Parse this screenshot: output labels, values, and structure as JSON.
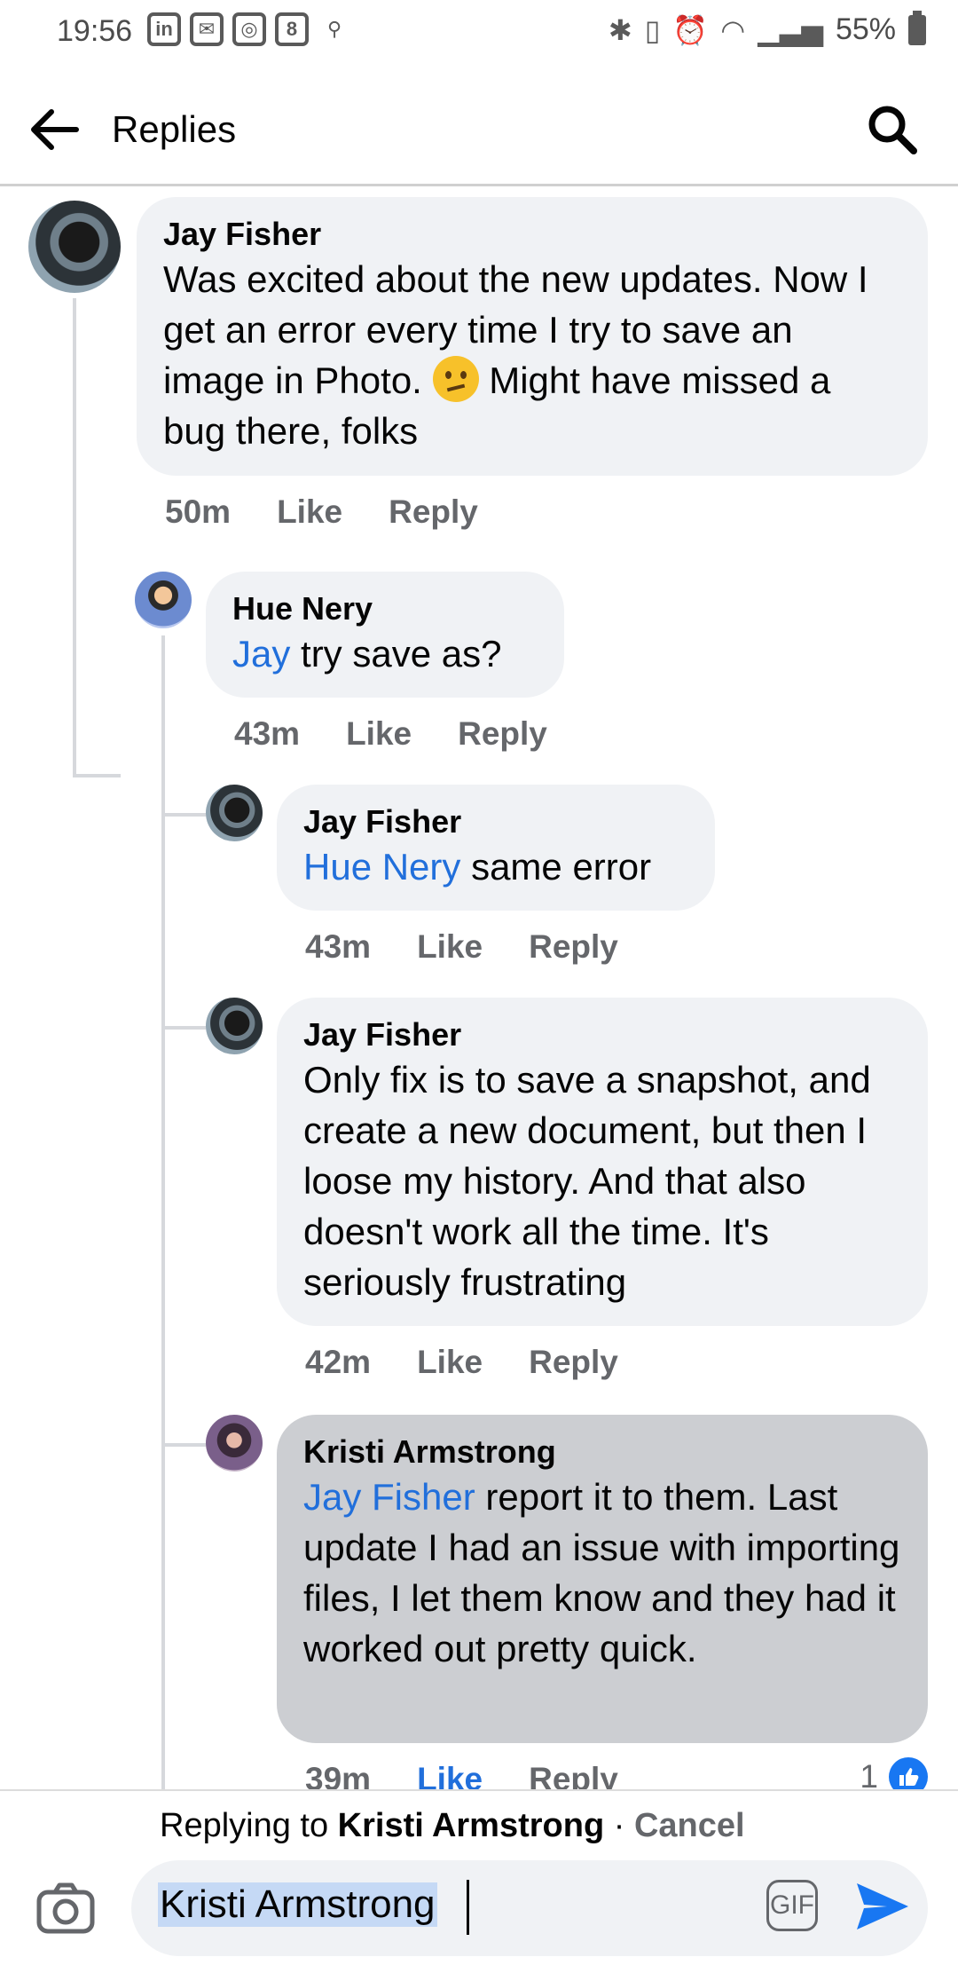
{
  "status_bar": {
    "time": "19:56",
    "battery": "55%"
  },
  "header": {
    "title": "Replies"
  },
  "comments": [
    {
      "author": "Jay Fisher",
      "mention": "",
      "text_before": "Was excited about the new updates. Now I get an error every time I try to save an image in Photo.",
      "text_after": "Might have missed a bug there, folks",
      "time": "50m",
      "like": "Like",
      "reply": "Reply"
    },
    {
      "author": "Hue Nery",
      "mention": "Jay",
      "text": " try save as?",
      "time": "43m",
      "like": "Like",
      "reply": "Reply"
    },
    {
      "author": "Jay Fisher",
      "mention": "Hue Nery",
      "text": " same error",
      "time": "43m",
      "like": "Like",
      "reply": "Reply"
    },
    {
      "author": "Jay Fisher",
      "mention": "",
      "text": "Only fix is to save a snapshot, and create a new document, but then I loose my history. And that also doesn't work all the time. It's seriously frustrating",
      "time": "42m",
      "like": "Like",
      "reply": "Reply"
    },
    {
      "author": "Kristi Armstrong",
      "mention": "Jay Fisher",
      "text": " report it to them. Last update I had an issue with importing files, I let them know and they had it worked out pretty quick.",
      "time": "39m",
      "like": "Like",
      "reply": "Reply",
      "reaction_count": "1"
    }
  ],
  "composer": {
    "replying_prefix": "Replying to ",
    "replying_name": "Kristi Armstrong",
    "separator": " · ",
    "cancel": "Cancel",
    "input_value": "Kristi Armstrong",
    "gif": "GIF"
  },
  "icons": {
    "emoji": "confused-face-emoji",
    "reaction": "thumbs-up-icon",
    "accent": "#216fdb"
  }
}
